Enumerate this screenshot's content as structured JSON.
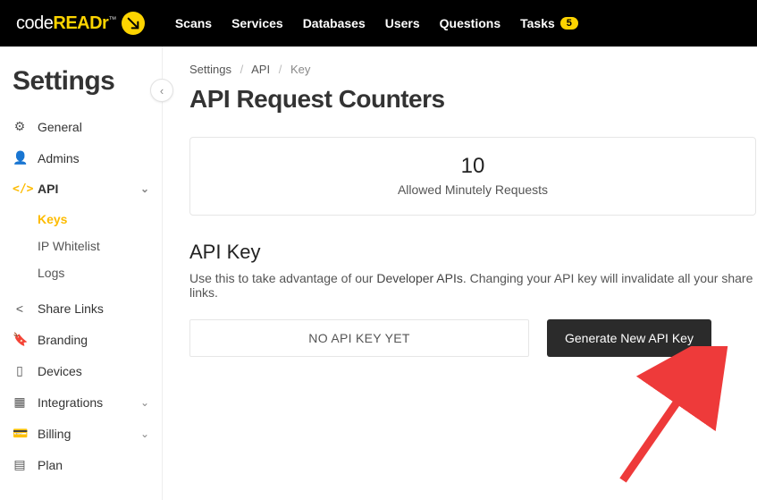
{
  "brand": {
    "pre": "code",
    "bold": "READr",
    "tm": "™"
  },
  "nav": {
    "scans": "Scans",
    "services": "Services",
    "databases": "Databases",
    "users": "Users",
    "questions": "Questions",
    "tasks": "Tasks",
    "tasks_badge": "5"
  },
  "sidebar": {
    "title": "Settings",
    "general": "General",
    "admins": "Admins",
    "api": "API",
    "api_sub": {
      "keys": "Keys",
      "ip_whitelist": "IP Whitelist",
      "logs": "Logs"
    },
    "share_links": "Share Links",
    "branding": "Branding",
    "devices": "Devices",
    "integrations": "Integrations",
    "billing": "Billing",
    "plan": "Plan"
  },
  "breadcrumb": {
    "a": "Settings",
    "b": "API",
    "c": "Key"
  },
  "page_title": "API Request Counters",
  "counter": {
    "value": "10",
    "label": "Allowed Minutely Requests"
  },
  "api_key": {
    "heading": "API Key",
    "desc_pre": "Use this to take advantage of our ",
    "desc_link": "Developer APIs",
    "desc_post": ". Changing your API key will invalidate all your share links.",
    "empty": "NO API KEY YET",
    "generate": "Generate New API Key"
  }
}
